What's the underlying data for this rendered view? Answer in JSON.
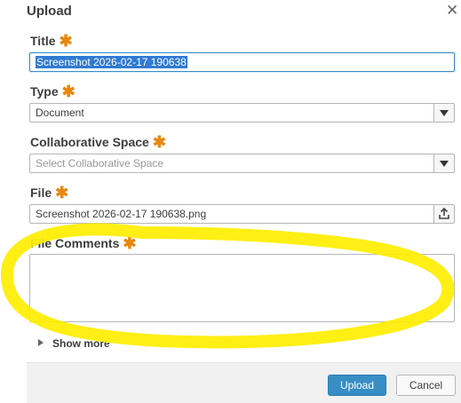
{
  "dialog": {
    "title": "Upload",
    "close_glyph": "✕",
    "required_marker": "✱"
  },
  "fields": {
    "title": {
      "label": "Title",
      "value_selected": "Screenshot 2026-02-17 190638"
    },
    "type": {
      "label": "Type",
      "value": "Document"
    },
    "collab_space": {
      "label": "Collaborative Space",
      "placeholder": "Select Collaborative Space"
    },
    "file": {
      "label": "File",
      "value": "Screenshot 2026-02-17 190638.png"
    },
    "file_comments": {
      "label": "File Comments",
      "value": ""
    }
  },
  "show_more": {
    "label": "Show more"
  },
  "footer": {
    "upload_label": "Upload",
    "cancel_label": "Cancel"
  },
  "colors": {
    "required_star": "#e8870e",
    "primary_button": "#368ec4",
    "selection_highlight": "#2f7ad3",
    "annotation_highlight": "#ffee00"
  },
  "icons": {
    "close": "close-icon",
    "dropdown": "chevron-down-icon",
    "upload": "upload-icon",
    "expand": "caret-right-icon"
  }
}
